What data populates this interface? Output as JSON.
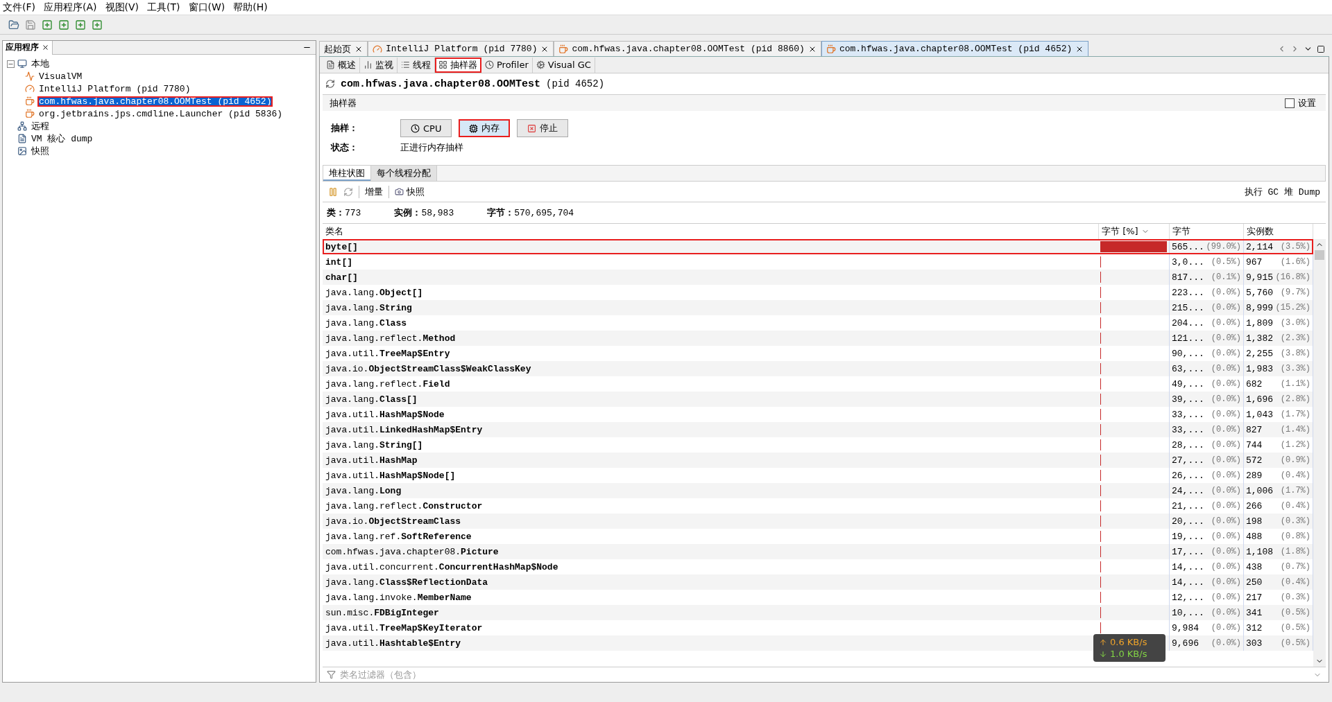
{
  "menu": [
    "文件(F)",
    "应用程序(A)",
    "视图(V)",
    "工具(T)",
    "窗口(W)",
    "帮助(H)"
  ],
  "apps_panel": {
    "title": "应用程序",
    "tree": [
      {
        "label": "本地",
        "kind": "computer",
        "expanded": true,
        "children": [
          {
            "label": "VisualVM",
            "kind": "visualvm",
            "selected": false,
            "annotated": false
          },
          {
            "label": "IntelliJ Platform (pid 7780)",
            "kind": "intellij",
            "selected": false,
            "annotated": false
          },
          {
            "label": "com.hfwas.java.chapter08.OOMTest (pid 4652)",
            "kind": "java",
            "selected": true,
            "annotated": true
          },
          {
            "label": "org.jetbrains.jps.cmdline.Launcher (pid 5836)",
            "kind": "java",
            "selected": false,
            "annotated": false
          }
        ]
      },
      {
        "label": "远程",
        "kind": "remote",
        "expanded": false
      },
      {
        "label": "VM 核心 dump",
        "kind": "dump",
        "expanded": false
      },
      {
        "label": "快照",
        "kind": "snapshot",
        "expanded": false
      }
    ]
  },
  "doc_tabs": [
    {
      "label": "起始页",
      "kind": "none",
      "selected": false
    },
    {
      "label": "IntelliJ Platform (pid 7780)",
      "kind": "intellij",
      "selected": false
    },
    {
      "label": "com.hfwas.java.chapter08.OOMTest (pid 8860)",
      "kind": "java",
      "selected": false
    },
    {
      "label": "com.hfwas.java.chapter08.OOMTest (pid 4652)",
      "kind": "java",
      "selected": true
    }
  ],
  "sub_tabs": [
    {
      "label": "概述",
      "kind": "overview",
      "selected": false,
      "annotated": false
    },
    {
      "label": "监视",
      "kind": "monitor",
      "selected": false,
      "annotated": false
    },
    {
      "label": "线程",
      "kind": "threads",
      "selected": false,
      "annotated": false
    },
    {
      "label": "抽样器",
      "kind": "sampler",
      "selected": true,
      "annotated": true
    },
    {
      "label": "Profiler",
      "kind": "profiler",
      "selected": false,
      "annotated": false
    },
    {
      "label": "Visual GC",
      "kind": "gc",
      "selected": false,
      "annotated": false
    }
  ],
  "title": {
    "name": "com.hfwas.java.chapter08.OOMTest",
    "pid": "(pid 4652)"
  },
  "section": {
    "label": "抽样器",
    "settings": {
      "label": "设置",
      "checked": false
    }
  },
  "sample": {
    "label": "抽样：",
    "buttons": [
      {
        "label": "CPU",
        "kind": "cpu",
        "selected": false,
        "annotated": false
      },
      {
        "label": "内存",
        "kind": "memory",
        "selected": true,
        "annotated": true
      },
      {
        "label": "停止",
        "kind": "stop",
        "selected": false,
        "annotated": false
      }
    ],
    "status_label": "状态：",
    "status": "正进行内存抽样"
  },
  "view_tabs": [
    {
      "label": "堆柱状图",
      "selected": true
    },
    {
      "label": "每个线程分配",
      "selected": false
    }
  ],
  "view_toolbar": {
    "delta": "增量",
    "snapshot": "快照",
    "gc": "执行 GC",
    "dump": "堆 Dump"
  },
  "stats": [
    {
      "label": "类：",
      "value": "773"
    },
    {
      "label": "实例：",
      "value": "58,983"
    },
    {
      "label": "字节：",
      "value": "570,695,704"
    }
  ],
  "table": {
    "columns": [
      {
        "label": "类名",
        "sorted": false
      },
      {
        "label": "字节 [%]",
        "sorted": true
      },
      {
        "label": "字节",
        "sorted": false
      },
      {
        "label": "实例数",
        "sorted": false
      }
    ],
    "rows": [
      {
        "package": "",
        "name": "byte[]",
        "level": 0.99,
        "bytes": "565...",
        "bytes_pct": "(99.0%)",
        "instances": "2,114",
        "instances_pct": "(3.5%)",
        "annotated": true
      },
      {
        "package": "",
        "name": "int[]",
        "level": 0.005,
        "bytes": "3,0...",
        "bytes_pct": "(0.5%)",
        "instances": "967",
        "instances_pct": "(1.6%)",
        "annotated": false
      },
      {
        "package": "",
        "name": "char[]",
        "level": 0.001,
        "bytes": "817...",
        "bytes_pct": "(0.1%)",
        "instances": "9,915",
        "instances_pct": "(16.8%)",
        "annotated": false
      },
      {
        "package": "java.lang.",
        "name": "Object[]",
        "level": 0,
        "bytes": "223...",
        "bytes_pct": "(0.0%)",
        "instances": "5,760",
        "instances_pct": "(9.7%)",
        "annotated": false
      },
      {
        "package": "java.lang.",
        "name": "String",
        "level": 0,
        "bytes": "215...",
        "bytes_pct": "(0.0%)",
        "instances": "8,999",
        "instances_pct": "(15.2%)",
        "annotated": false
      },
      {
        "package": "java.lang.",
        "name": "Class",
        "level": 0,
        "bytes": "204...",
        "bytes_pct": "(0.0%)",
        "instances": "1,809",
        "instances_pct": "(3.0%)",
        "annotated": false
      },
      {
        "package": "java.lang.reflect.",
        "name": "Method",
        "level": 0,
        "bytes": "121...",
        "bytes_pct": "(0.0%)",
        "instances": "1,382",
        "instances_pct": "(2.3%)",
        "annotated": false
      },
      {
        "package": "java.util.",
        "name": "TreeMap$Entry",
        "level": 0,
        "bytes": "90,...",
        "bytes_pct": "(0.0%)",
        "instances": "2,255",
        "instances_pct": "(3.8%)",
        "annotated": false
      },
      {
        "package": "java.io.",
        "name": "ObjectStreamClass$WeakClassKey",
        "level": 0,
        "bytes": "63,...",
        "bytes_pct": "(0.0%)",
        "instances": "1,983",
        "instances_pct": "(3.3%)",
        "annotated": false
      },
      {
        "package": "java.lang.reflect.",
        "name": "Field",
        "level": 0,
        "bytes": "49,...",
        "bytes_pct": "(0.0%)",
        "instances": "682",
        "instances_pct": "(1.1%)",
        "annotated": false
      },
      {
        "package": "java.lang.",
        "name": "Class[]",
        "level": 0,
        "bytes": "39,...",
        "bytes_pct": "(0.0%)",
        "instances": "1,696",
        "instances_pct": "(2.8%)",
        "annotated": false
      },
      {
        "package": "java.util.",
        "name": "HashMap$Node",
        "level": 0,
        "bytes": "33,...",
        "bytes_pct": "(0.0%)",
        "instances": "1,043",
        "instances_pct": "(1.7%)",
        "annotated": false
      },
      {
        "package": "java.util.",
        "name": "LinkedHashMap$Entry",
        "level": 0,
        "bytes": "33,...",
        "bytes_pct": "(0.0%)",
        "instances": "827",
        "instances_pct": "(1.4%)",
        "annotated": false
      },
      {
        "package": "java.lang.",
        "name": "String[]",
        "level": 0,
        "bytes": "28,...",
        "bytes_pct": "(0.0%)",
        "instances": "744",
        "instances_pct": "(1.2%)",
        "annotated": false
      },
      {
        "package": "java.util.",
        "name": "HashMap",
        "level": 0,
        "bytes": "27,...",
        "bytes_pct": "(0.0%)",
        "instances": "572",
        "instances_pct": "(0.9%)",
        "annotated": false
      },
      {
        "package": "java.util.",
        "name": "HashMap$Node[]",
        "level": 0,
        "bytes": "26,...",
        "bytes_pct": "(0.0%)",
        "instances": "289",
        "instances_pct": "(0.4%)",
        "annotated": false
      },
      {
        "package": "java.lang.",
        "name": "Long",
        "level": 0,
        "bytes": "24,...",
        "bytes_pct": "(0.0%)",
        "instances": "1,006",
        "instances_pct": "(1.7%)",
        "annotated": false
      },
      {
        "package": "java.lang.reflect.",
        "name": "Constructor",
        "level": 0,
        "bytes": "21,...",
        "bytes_pct": "(0.0%)",
        "instances": "266",
        "instances_pct": "(0.4%)",
        "annotated": false
      },
      {
        "package": "java.io.",
        "name": "ObjectStreamClass",
        "level": 0,
        "bytes": "20,...",
        "bytes_pct": "(0.0%)",
        "instances": "198",
        "instances_pct": "(0.3%)",
        "annotated": false
      },
      {
        "package": "java.lang.ref.",
        "name": "SoftReference",
        "level": 0,
        "bytes": "19,...",
        "bytes_pct": "(0.0%)",
        "instances": "488",
        "instances_pct": "(0.8%)",
        "annotated": false
      },
      {
        "package": "com.hfwas.java.chapter08.",
        "name": "Picture",
        "level": 0,
        "bytes": "17,...",
        "bytes_pct": "(0.0%)",
        "instances": "1,108",
        "instances_pct": "(1.8%)",
        "annotated": false
      },
      {
        "package": "java.util.concurrent.",
        "name": "ConcurrentHashMap$Node",
        "level": 0,
        "bytes": "14,...",
        "bytes_pct": "(0.0%)",
        "instances": "438",
        "instances_pct": "(0.7%)",
        "annotated": false
      },
      {
        "package": "java.lang.",
        "name": "Class$ReflectionData",
        "level": 0,
        "bytes": "14,...",
        "bytes_pct": "(0.0%)",
        "instances": "250",
        "instances_pct": "(0.4%)",
        "annotated": false
      },
      {
        "package": "java.lang.invoke.",
        "name": "MemberName",
        "level": 0,
        "bytes": "12,...",
        "bytes_pct": "(0.0%)",
        "instances": "217",
        "instances_pct": "(0.3%)",
        "annotated": false
      },
      {
        "package": "sun.misc.",
        "name": "FDBigInteger",
        "level": 0,
        "bytes": "10,...",
        "bytes_pct": "(0.0%)",
        "instances": "341",
        "instances_pct": "(0.5%)",
        "annotated": false
      },
      {
        "package": "java.util.",
        "name": "TreeMap$KeyIterator",
        "level": 0,
        "bytes": "9,984",
        "bytes_pct": "(0.0%)",
        "instances": "312",
        "instances_pct": "(0.5%)",
        "annotated": false
      },
      {
        "package": "java.util.",
        "name": "Hashtable$Entry",
        "level": 0,
        "bytes": "9,696",
        "bytes_pct": "(0.0%)",
        "instances": "303",
        "instances_pct": "(0.5%)",
        "annotated": false
      }
    ]
  },
  "filter": {
    "placeholder": "类名过滤器（包含）"
  },
  "net_widget": {
    "up": "0.6 KB/s",
    "down": "1.0 KB/s"
  }
}
